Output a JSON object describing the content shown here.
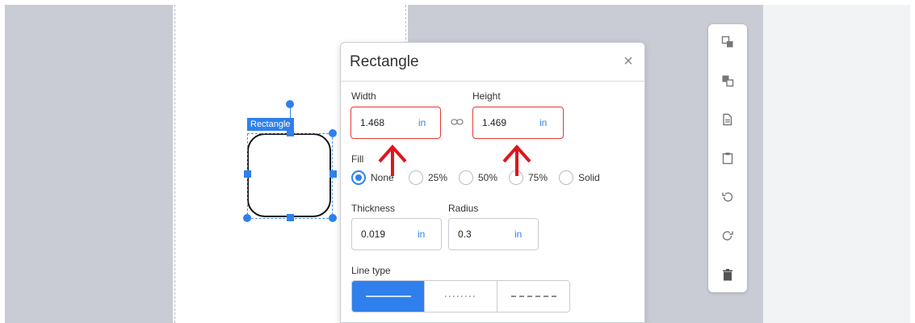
{
  "canvas": {
    "shape_tag": "Rectangle"
  },
  "toolbar": {
    "items": [
      {
        "icon": "bring-forward-icon"
      },
      {
        "icon": "send-backward-icon"
      },
      {
        "icon": "copy-icon"
      },
      {
        "icon": "paste-icon"
      },
      {
        "icon": "undo-icon"
      },
      {
        "icon": "redo-icon"
      },
      {
        "icon": "delete-icon"
      }
    ]
  },
  "dialog": {
    "title": "Rectangle",
    "close_icon": "×",
    "width": {
      "label": "Width",
      "value": "1.468",
      "unit": "in"
    },
    "height": {
      "label": "Height",
      "value": "1.469",
      "unit": "in"
    },
    "link_icon": "link-icon",
    "fill": {
      "label": "Fill",
      "options": [
        "None",
        "25%",
        "50%",
        "75%",
        "Solid"
      ],
      "selected": "None"
    },
    "thickness": {
      "label": "Thickness",
      "value": "0.019",
      "unit": "in"
    },
    "radius": {
      "label": "Radius",
      "value": "0.3",
      "unit": "in"
    },
    "line_type": {
      "label": "Line type",
      "options": [
        "solid",
        "dotted",
        "dashed"
      ],
      "selected": "solid"
    }
  },
  "colors": {
    "accent": "#2f80ed",
    "highlight": "#e53935",
    "annotation_arrow": "#e0141c"
  }
}
